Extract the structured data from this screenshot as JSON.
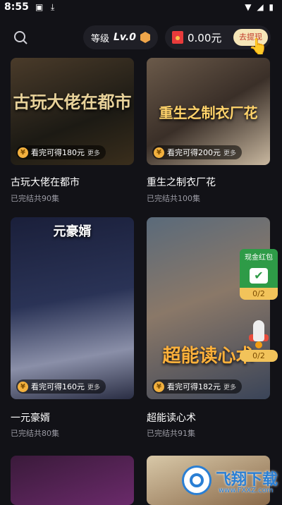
{
  "status_bar": {
    "time": "8:55"
  },
  "header": {
    "level_label": "等级",
    "level_value": "Lv.0",
    "balance": "0.00元",
    "withdraw_label": "去提现"
  },
  "dramas": [
    {
      "title": "古玩大佬在都市",
      "status": "已完结共90集",
      "art_text": "古玩大佬在都市",
      "reward_text": "看完可得180元",
      "reward_more": "更多"
    },
    {
      "title": "重生之制衣厂花",
      "status": "已完结共100集",
      "art_text": "重生之制衣厂花",
      "reward_text": "看完可得200元",
      "reward_more": "更多"
    },
    {
      "title": "一元豪婿",
      "status": "已完结共80集",
      "art_text": "元豪婿",
      "reward_text": "看完可得160元",
      "reward_more": "更多"
    },
    {
      "title": "超能读心术",
      "status": "已完结共91集",
      "art_text": "超能读心术",
      "reward_text": "看完可得182元",
      "reward_more": "更多"
    }
  ],
  "floating": {
    "redpacket_label": "现金红包",
    "redpacket_count": "0/2",
    "rocket_count": "0/2"
  },
  "watermark": {
    "brand": "飞翔下载",
    "url": "www.FXXZ.com"
  },
  "colors": {
    "background": "#121217",
    "coin": "#f3b13e",
    "accent_green": "#2e9b47",
    "withdraw_bg": "#f6e6b8"
  }
}
